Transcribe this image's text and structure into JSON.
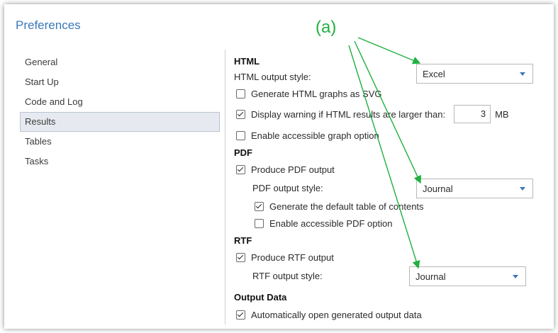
{
  "window": {
    "title": "Preferences"
  },
  "nav": {
    "items": [
      {
        "label": "General",
        "selected": false
      },
      {
        "label": "Start Up",
        "selected": false
      },
      {
        "label": "Code and Log",
        "selected": false
      },
      {
        "label": "Results",
        "selected": true
      },
      {
        "label": "Tables",
        "selected": false
      },
      {
        "label": "Tasks",
        "selected": false
      }
    ]
  },
  "html": {
    "heading": "HTML",
    "output_style_label": "HTML output style:",
    "output_style_value": "Excel",
    "svg_label": "Generate HTML graphs as SVG",
    "svg_checked": false,
    "warning_label": "Display warning if HTML results are larger than:",
    "warning_checked": true,
    "warning_value": "3",
    "warning_unit": "MB",
    "accessible_label": "Enable accessible graph option",
    "accessible_checked": false
  },
  "pdf": {
    "heading": "PDF",
    "produce_label": "Produce PDF output",
    "produce_checked": true,
    "output_style_label": "PDF output style:",
    "output_style_value": "Journal",
    "toc_label": "Generate the default table of contents",
    "toc_checked": true,
    "accessible_label": "Enable accessible PDF option",
    "accessible_checked": false
  },
  "rtf": {
    "heading": "RTF",
    "produce_label": "Produce RTF output",
    "produce_checked": true,
    "output_style_label": "RTF output style:",
    "output_style_value": "Journal"
  },
  "output_data": {
    "heading": "Output Data",
    "open_label": "Automatically open generated output data",
    "open_checked": true
  },
  "annotation": {
    "label": "(a)",
    "color": "#20b040"
  }
}
